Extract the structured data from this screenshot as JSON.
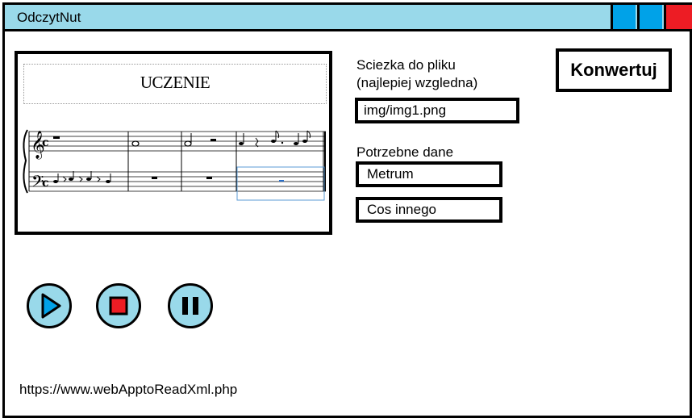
{
  "window": {
    "title": "OdczytNut",
    "controls": [
      "minimize-icon",
      "maximize-icon",
      "close-icon"
    ],
    "colors": {
      "titlebar": "#99d9ea",
      "min": "#00a2e8",
      "max": "#00a2e8",
      "close": "#ed1c24"
    }
  },
  "score": {
    "title": "UCZENIE"
  },
  "file": {
    "label_line1": "Sciezka do pliku",
    "label_line2": "(najlepiej wzgledna)",
    "value": "img/img1.png"
  },
  "data_section": {
    "label": "Potrzebne dane",
    "field1": "Metrum",
    "field2": "Cos innego"
  },
  "convert_button": "Konwertuj",
  "player": {
    "buttons": [
      "play-icon",
      "stop-icon",
      "pause-icon"
    ],
    "colors": {
      "button_bg": "#99d9ea",
      "play": "#00a2e8",
      "stop": "#ed1c24",
      "pause": "#000000"
    }
  },
  "url": "https://www.webApptoReadXml.php"
}
